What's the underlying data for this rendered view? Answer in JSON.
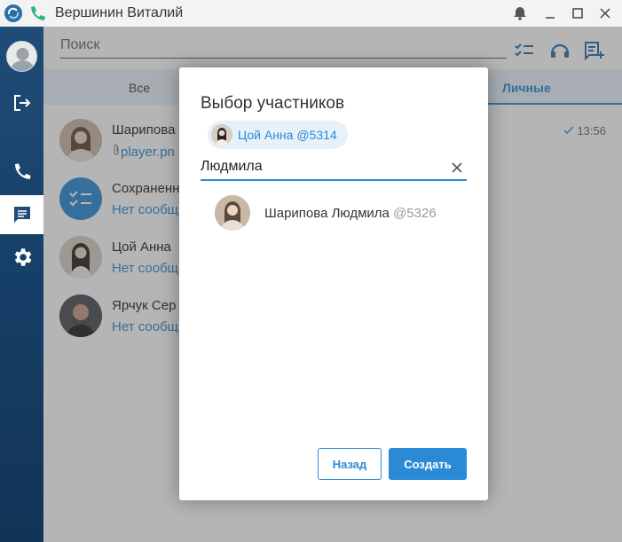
{
  "window": {
    "title": "Вершинин Виталий",
    "sip_badge": "SIP"
  },
  "colors": {
    "accent": "#2b8ad6",
    "rail": "#17416a"
  },
  "main": {
    "search_placeholder": "Поиск",
    "tabs": [
      {
        "label": "Все"
      },
      {
        "label": "Личные",
        "active": true
      }
    ],
    "chats": [
      {
        "name": "Шарипова",
        "subtitle": "player.pn",
        "time": "13:56",
        "icon": "attachment-icon"
      },
      {
        "name": "Сохраненн",
        "subtitle": "Нет сообщ"
      },
      {
        "name": "Цой Анна",
        "subtitle": "Нет сообщ"
      },
      {
        "name": "Ярчук Сер",
        "subtitle": "Нет сообщ"
      }
    ]
  },
  "modal": {
    "title": "Выбор участников",
    "selected_chip": "Цой Анна @5314",
    "search_value": "Людмила",
    "result": {
      "name": "Шарипова Людмила",
      "tag": "@5326"
    },
    "back_label": "Назад",
    "create_label": "Создать"
  }
}
